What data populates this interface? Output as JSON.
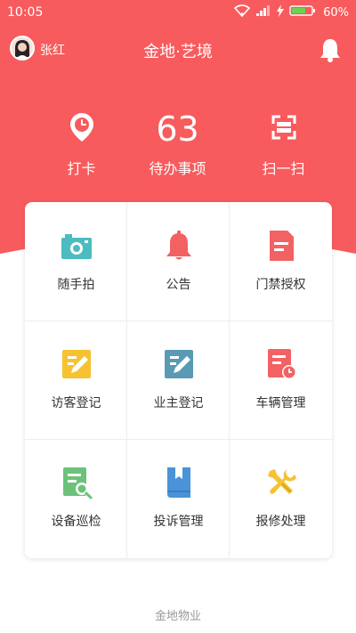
{
  "colors": {
    "primary": "#f85b5d",
    "teal": "#4dbcc0",
    "red": "#f26263",
    "yellow": "#f6c232",
    "steel": "#5a9ab5",
    "green": "#6cc27a",
    "blue": "#4a93d8"
  },
  "status_bar": {
    "time": "10:05",
    "battery": "60%"
  },
  "header": {
    "user_name": "张红",
    "title": "金地·艺境"
  },
  "quick_actions": {
    "clock_in": {
      "label": "打卡",
      "icon": "clock-pin-icon"
    },
    "todo": {
      "count": "63",
      "label": "待办事项"
    },
    "scan": {
      "label": "扫一扫",
      "icon": "scan-icon"
    }
  },
  "grid_items": [
    {
      "label": "随手拍",
      "icon": "camera-icon"
    },
    {
      "label": "公告",
      "icon": "bell-icon"
    },
    {
      "label": "门禁授权",
      "icon": "document-icon"
    },
    {
      "label": "访客登记",
      "icon": "edit-icon"
    },
    {
      "label": "业主登记",
      "icon": "edit-icon"
    },
    {
      "label": "车辆管理",
      "icon": "document-clock-icon"
    },
    {
      "label": "设备巡检",
      "icon": "document-search-icon"
    },
    {
      "label": "投诉管理",
      "icon": "book-icon"
    },
    {
      "label": "报修处理",
      "icon": "wrench-screwdriver-icon"
    }
  ],
  "footer": {
    "text": "金地物业"
  }
}
